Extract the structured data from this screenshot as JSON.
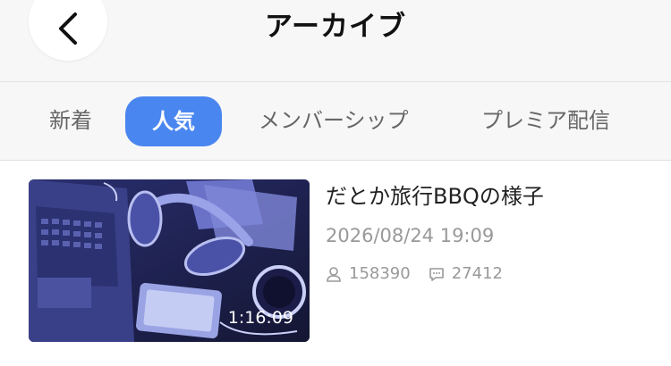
{
  "header": {
    "title": "アーカイブ",
    "back_icon": "chevron-left-icon"
  },
  "tabs": [
    {
      "label": "新着",
      "active": false
    },
    {
      "label": "人気",
      "active": true
    },
    {
      "label": "メンバーシップ",
      "active": false
    },
    {
      "label": "プレミア配信",
      "active": false
    }
  ],
  "colors": {
    "accent": "#4a86f0",
    "header_bg": "#f7f7f7",
    "muted_text": "#999999"
  },
  "videos": [
    {
      "title": "だとか旅行BBQの様子",
      "date": "2026/08/24 19:09",
      "duration": "1:16:09",
      "views": "158390",
      "comments": "27412",
      "views_icon": "person-icon",
      "comments_icon": "comment-icon"
    }
  ]
}
